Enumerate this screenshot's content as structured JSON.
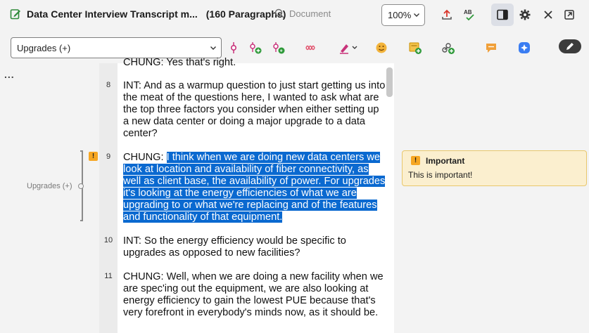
{
  "header": {
    "doc_title": "Data Center Interview Transcript m...",
    "paragraph_count": "(160 Paragraphs)",
    "search_placeholder": "Document",
    "zoom": "100%"
  },
  "toolbar": {
    "code_select_value": "Upgrades (+)"
  },
  "left_rail": {
    "more": "...",
    "stripe_label": "Upgrades (+)"
  },
  "paragraphs": [
    {
      "num": "",
      "text": "CHUNG:  Yes that's right."
    },
    {
      "num": "8",
      "text": "INT:  And as a warmup question to just start getting us into the meat of the questions here, I wanted to ask what are the top three factors you consider when either setting up a new data center or doing a major upgrade to a data center?"
    },
    {
      "num": "9",
      "prefix": "CHUNG:  ",
      "text": "I think when we are doing new data centers we look at location and availability of fiber connectivity, as well as client base, the availability of power.  For upgrades it's looking at the energy efficiencies of what we are upgrading to or what we're replacing and of the features and functionality of that equipment."
    },
    {
      "num": "10",
      "text": "INT:  So the energy efficiency would be specific to upgrades as opposed to new facilities?"
    },
    {
      "num": "11",
      "text": "CHUNG:  Well, when we are doing a new facility when we are spec'ing out the equipment, we are also looking at energy efficiency to gain the lowest PUE because that's very forefront in everybody's minds now, as it should be."
    }
  ],
  "memo": {
    "badge": "!",
    "title": "Important",
    "body": "This is important!"
  },
  "colors": {
    "highlight": "#0a69d0",
    "memo_bg": "#fbefcf",
    "warning": "#f6a623"
  }
}
